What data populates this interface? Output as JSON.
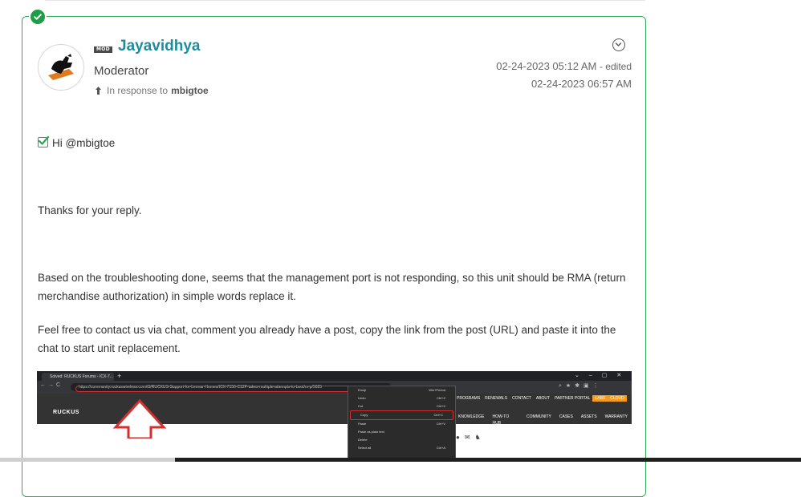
{
  "post": {
    "author": "Jayavidhya",
    "mod_badge": "MOD",
    "rank": "Moderator",
    "in_response_prefix": "In response to",
    "in_response_user": "mbigtoe",
    "date_posted": "02-24-2023 05:12 AM",
    "edited_label": "- edited",
    "date_edited": "02-24-2023 06:57 AM",
    "greeting": "Hi @mbigtoe",
    "para1": "Thanks for your reply.",
    "para2": "Based on the troubleshooting done, seems that the management port is not  responding, so  this unit should be RMA (return merchandise authorization) in simple words replace it.",
    "para3": "Feel free to contact us via chat, comment you already have a post, copy the link from the post (URL) and paste it into the chat to start unit replacement."
  },
  "embedded_screenshot": {
    "tab_title": "Solved: RUCKUS Forums - ICX-7...",
    "url": "https://community.ruckuswireless.com/t5/RUCKUS-Support-for-Lennar-Homes/ICX-7150-C12P-takes-multiple-attempts-to-boot/m-p/5025",
    "logo": "RUCKUS",
    "nav_top": [
      "PROGRAMS",
      "RENEWALS",
      "CONTACT",
      "ABOUT",
      "PARTNER PORTAL",
      "LABS",
      "CLOUD"
    ],
    "nav_main": [
      "KNOWLEDGE",
      "HOW-TO HUB",
      "COMMUNITY",
      "CASES",
      "ASSETS",
      "WARRANTY"
    ],
    "context_menu": [
      {
        "label": "Emoji",
        "shortcut": "Win+Period"
      },
      {
        "label": "Undo",
        "shortcut": "Ctrl+Z"
      },
      {
        "label": "Cut",
        "shortcut": "Ctrl+X"
      },
      {
        "label": "Copy",
        "shortcut": "Ctrl+C"
      },
      {
        "label": "Paste",
        "shortcut": "Ctrl+V"
      },
      {
        "label": "Paste as plain text",
        "shortcut": ""
      },
      {
        "label": "Delete",
        "shortcut": ""
      },
      {
        "label": "Select all",
        "shortcut": "Ctrl+A"
      }
    ]
  },
  "colors": {
    "accent_border": "#3aa757",
    "author": "#1c8e9b",
    "solved_badge": "#1f9d46"
  }
}
